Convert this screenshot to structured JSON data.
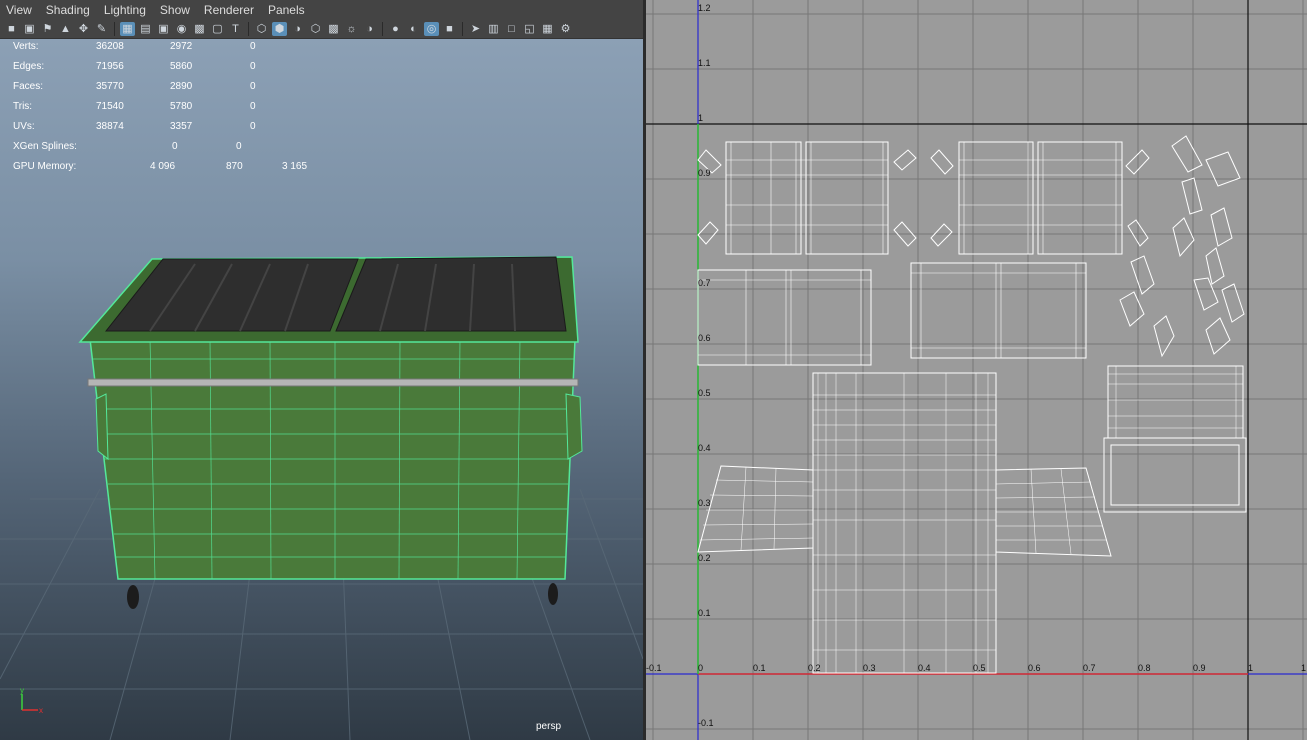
{
  "menubar": {
    "items": [
      "View",
      "Shading",
      "Lighting",
      "Show",
      "Renderer",
      "Panels"
    ]
  },
  "toolbar": {
    "icons": [
      "camera-select-icon",
      "camera-attrs-icon",
      "bookmark-icon",
      "image-plane-icon",
      "two-d-pan-icon",
      "grease-pencil-icon",
      "grid-icon",
      "film-gate-icon",
      "resolution-gate-icon",
      "gate-mask-icon",
      "field-chart-icon",
      "safe-action-icon",
      "safe-title-icon",
      "wireframe-icon",
      "smooth-shade-icon",
      "use-default-material-icon",
      "wireframe-on-shaded-icon",
      "xray-icon",
      "use-all-lights-icon",
      "shadows-icon",
      "screen-space-ao-icon",
      "motion-blur-icon",
      "anti-aliasing-icon",
      "depth-of-field-icon",
      "isolate-select-icon",
      "xray-joints-icon",
      "xray-active-icon",
      "backface-culling-icon",
      "hud-icon",
      "render-override-icon"
    ]
  },
  "hud": {
    "rows": [
      {
        "label": "Verts:",
        "values": [
          "36208",
          "2972",
          "0"
        ]
      },
      {
        "label": "Edges:",
        "values": [
          "71956",
          "5860",
          "0"
        ]
      },
      {
        "label": "Faces:",
        "values": [
          "35770",
          "2890",
          "0"
        ]
      },
      {
        "label": "Tris:",
        "values": [
          "71540",
          "5780",
          "0"
        ]
      },
      {
        "label": "UVs:",
        "values": [
          "38874",
          "3357",
          "0"
        ]
      }
    ],
    "xgen": {
      "label": "XGen Splines:",
      "values": [
        "0",
        "0"
      ]
    },
    "gpu": {
      "label": "GPU Memory:",
      "values": [
        "4 096",
        "870",
        "3 165"
      ]
    }
  },
  "viewport": {
    "camera": "persp"
  },
  "axis_gizmo": {
    "x": "x",
    "y": "y"
  },
  "uv_editor": {
    "v_ticks": [
      "1.2",
      "1.1",
      "1",
      "0.9",
      "0.7",
      "0.6",
      "0.5",
      "0.4",
      "0.3",
      "0.2",
      "0.1",
      "-0.1"
    ],
    "u_ticks": [
      "-0.1",
      "0",
      "0.1",
      "0.2",
      "0.3",
      "0.4",
      "0.5",
      "0.6",
      "0.7",
      "0.8",
      "0.9",
      "1",
      "1"
    ]
  },
  "colors": {
    "wire_green": "#54e89a",
    "lid": "#2e2e2e",
    "bin_body": "#4a7a3a",
    "uv_bg": "#9b9b9b",
    "uv_grid": "#777777",
    "u_axis": "#d83030",
    "v_axis": "#2a2ad0",
    "v_axis_green": "#30c030"
  }
}
